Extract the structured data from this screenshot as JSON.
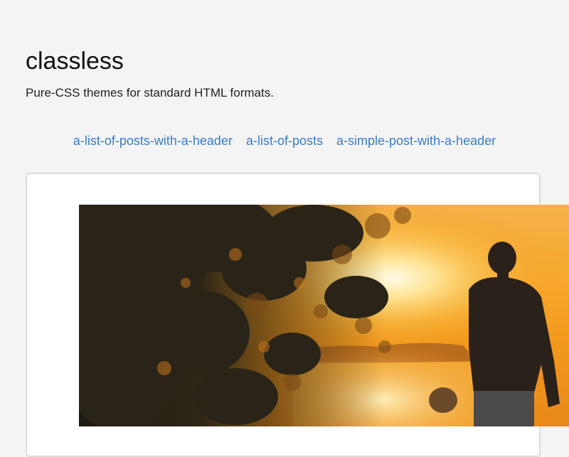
{
  "site": {
    "title": "classless",
    "tagline": "Pure-CSS themes for standard HTML formats."
  },
  "nav": {
    "links": [
      "a-list-of-posts-with-a-header",
      "a-list-of-posts",
      "a-simple-post-with-a-header"
    ]
  },
  "colors": {
    "background": "#f4f4f4",
    "link": "#3a7cc4",
    "card_border": "#dcdcdc"
  }
}
